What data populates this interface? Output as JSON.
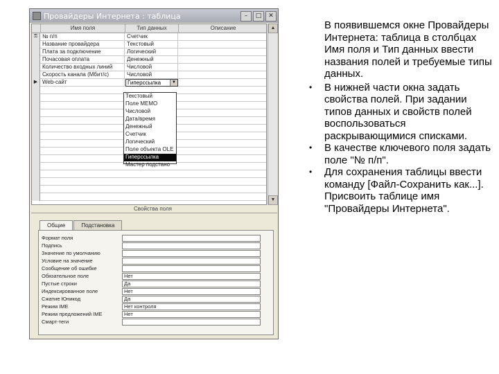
{
  "window": {
    "title": "Провайдеры Интернета : таблица",
    "controls": [
      "–",
      "□",
      "✕"
    ]
  },
  "grid": {
    "headers": [
      "Имя поля",
      "Тип данных",
      "Описание"
    ],
    "rows": [
      {
        "marker": "⚿",
        "name": "№ п/п",
        "type": "Счетчик"
      },
      {
        "marker": "",
        "name": "Название провайдера",
        "type": "Текстовый"
      },
      {
        "marker": "",
        "name": "Плата за подключение",
        "type": "Логический"
      },
      {
        "marker": "",
        "name": "Почасовая оплата",
        "type": "Денежный"
      },
      {
        "marker": "",
        "name": "Количество входных линий",
        "type": "Числовой"
      },
      {
        "marker": "",
        "name": "Скорость канала (Мбит/с)",
        "type": "Числовой"
      },
      {
        "marker": "▶",
        "name": "Web-сайт",
        "type": "Гиперссылка"
      }
    ],
    "dropdown": [
      "Текстовый",
      "Поле MEMO",
      "Числовой",
      "Дата/время",
      "Денежный",
      "Счетчик",
      "Логический",
      "Поле объекта OLE",
      "Гиперссылка",
      "Мастер подстано"
    ],
    "dropdown_selected": "Гиперссылка",
    "section_label": "Свойства поля"
  },
  "properties": {
    "tabs": [
      "Общие",
      "Подстановка"
    ],
    "active_tab": "Общие",
    "rows": [
      {
        "label": "Формат поля",
        "value": ""
      },
      {
        "label": "Подпись",
        "value": ""
      },
      {
        "label": "Значение по умолчанию",
        "value": ""
      },
      {
        "label": "Условие на значение",
        "value": ""
      },
      {
        "label": "Сообщение об ошибке",
        "value": ""
      },
      {
        "label": "Обязательное поле",
        "value": "Нет"
      },
      {
        "label": "Пустые строки",
        "value": "Да"
      },
      {
        "label": "Индексированное поле",
        "value": "Нет"
      },
      {
        "label": "Сжатие Юникод",
        "value": "Да"
      },
      {
        "label": "Режим IME",
        "value": "Нет контроля"
      },
      {
        "label": "Режим предложений IME",
        "value": "Нет"
      },
      {
        "label": "Смарт-теги",
        "value": ""
      }
    ]
  },
  "bullets": {
    "intro": "В появившемся окне Провайдеры Интернета: таблица в столбцах Имя поля и Тип данных ввести названия полей и требуемые типы данных.",
    "items": [
      "В нижней части окна задать свойства полей. При задании типов данных и свойств полей воспользоваться раскрывающимися списками.",
      "В качестве ключевого поля задать поле \"№ п/п\".",
      "Для сохранения таблицы ввести команду [Файл-Сохранить как...]. Присвоить таблице имя \"Провайдеры Интернета\"."
    ],
    "bullet_char": "•"
  }
}
